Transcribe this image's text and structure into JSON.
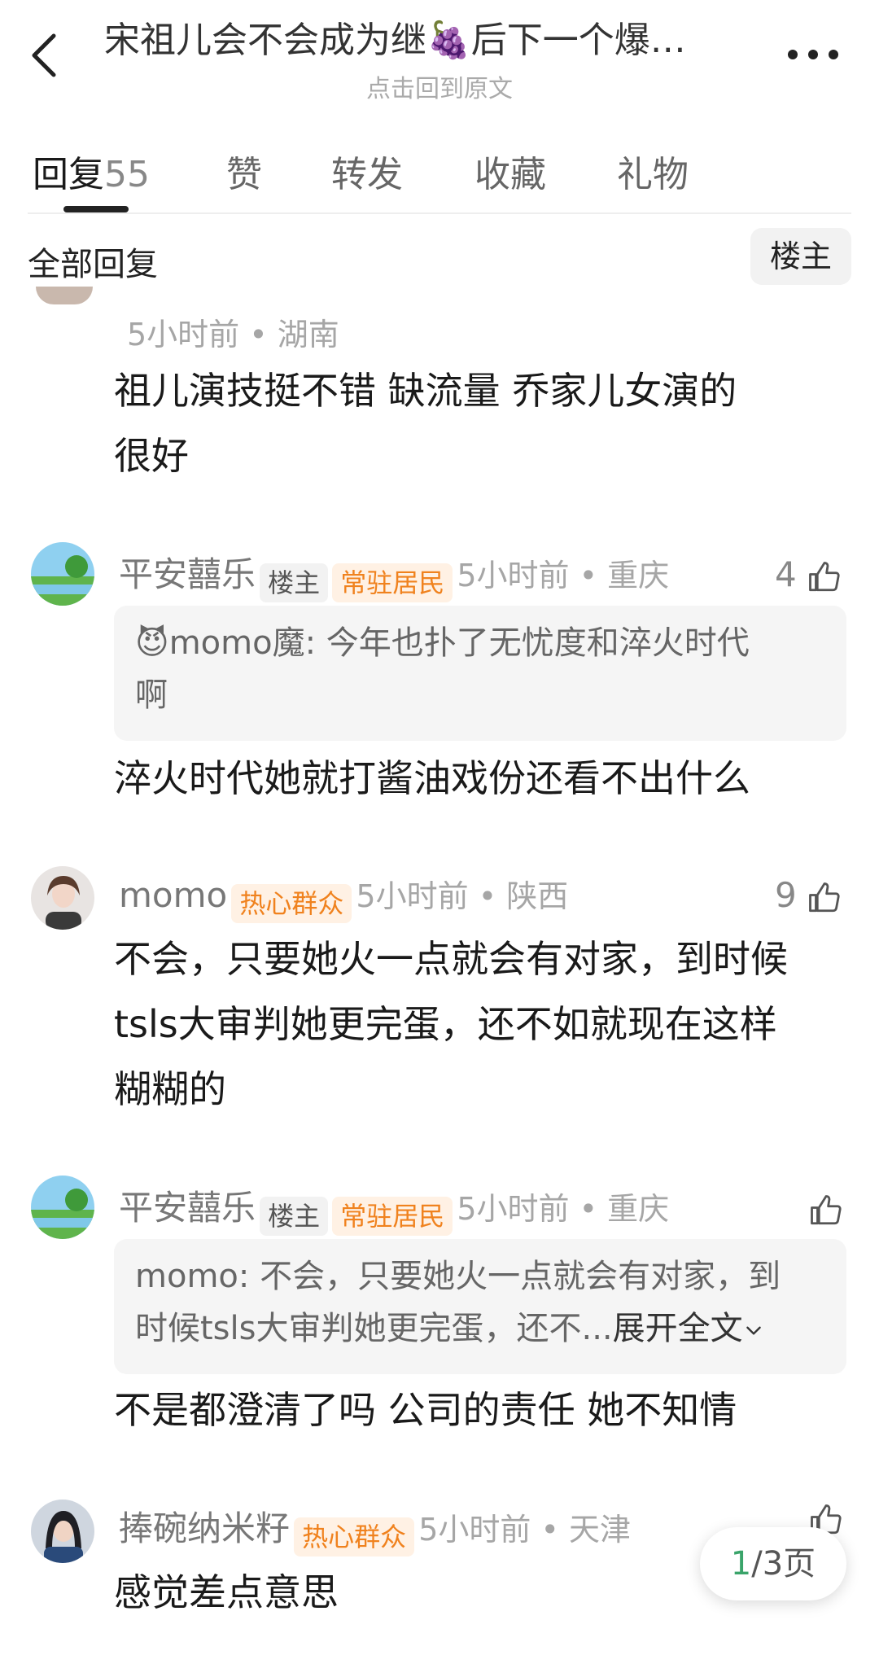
{
  "header": {
    "title": "宋祖儿会不会成为继🍇后下一个爆…",
    "subtitle": "点击回到原文"
  },
  "tabs": [
    {
      "label": "回复",
      "count": "55"
    },
    {
      "label": "赞"
    },
    {
      "label": "转发"
    },
    {
      "label": "收藏"
    },
    {
      "label": "礼物"
    }
  ],
  "filter": {
    "all_label": "全部回复",
    "op_label": "楼主"
  },
  "comments": [
    {
      "time": "5小时前",
      "location": "湖南",
      "text_line1": "祖儿演技挺不错 缺流量 乔家儿女演的",
      "text_line2": "很好"
    },
    {
      "username": "平安囍乐",
      "badge_op": "楼主",
      "badge": "常驻居民",
      "time": "5小时前",
      "location": "重庆",
      "likes": "4",
      "quote_emoji": "😈",
      "quote_name": "momo魔",
      "quote_text_line1": ": 今年也扑了无忧度和淬火时代",
      "quote_text_line2": "啊",
      "text": "淬火时代她就打酱油戏份还看不出什么"
    },
    {
      "username": "momo",
      "badge": "热心群众",
      "time": "5小时前",
      "location": "陕西",
      "likes": "9",
      "text_line1": "不会，只要她火一点就会有对家，到时候",
      "text_line2": "tsls大审判她更完蛋，还不如就现在这样",
      "text_line3": "糊糊的"
    },
    {
      "username": "平安囍乐",
      "badge_op": "楼主",
      "badge": "常驻居民",
      "time": "5小时前",
      "location": "重庆",
      "quote_name": "momo",
      "quote_text_line1": ": 不会，只要她火一点就会有对家，到",
      "quote_text_line2": "时候tsls大审判她更完蛋，还不...",
      "expand_label": "展开全文",
      "text": "不是都澄清了吗 公司的责任 她不知情"
    },
    {
      "username": "捧碗纳米籽",
      "badge": "热心群众",
      "time": "5小时前",
      "location": "天津",
      "text": "感觉差点意思"
    }
  ],
  "pager": {
    "current": "1",
    "total_label": "/3页"
  }
}
